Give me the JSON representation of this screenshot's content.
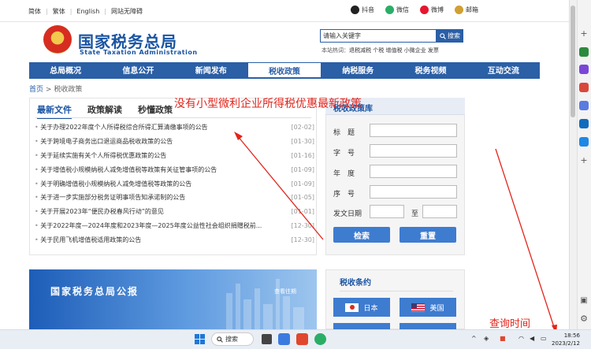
{
  "top_links": [
    "简体",
    "繁体",
    "English",
    "网站无障碍"
  ],
  "social": [
    {
      "label": "抖音",
      "color": "#222222"
    },
    {
      "label": "微信",
      "color": "#2aae67"
    },
    {
      "label": "微博",
      "color": "#e6162d"
    },
    {
      "label": "邮箱",
      "color": "#d0a030"
    }
  ],
  "header": {
    "logo_cn": "国家税务总局",
    "logo_en": "State Taxation Administration"
  },
  "search": {
    "value": "请输入关键字",
    "button": "搜索",
    "hot_label": "本站热词：",
    "hot_terms": "退税减税 个税 增值税 小微企业 发票"
  },
  "nav": [
    {
      "label": "总局概况",
      "active": false
    },
    {
      "label": "信息公开",
      "active": false
    },
    {
      "label": "新闻发布",
      "active": false
    },
    {
      "label": "税收政策",
      "active": true
    },
    {
      "label": "纳税服务",
      "active": false
    },
    {
      "label": "税务视频",
      "active": false
    },
    {
      "label": "互动交流",
      "active": false
    }
  ],
  "breadcrumb": {
    "home": "首页",
    "sep": ">",
    "current": "税收政策"
  },
  "tabs": [
    {
      "label": "最新文件",
      "active": true
    },
    {
      "label": "政策解读",
      "active": false
    },
    {
      "label": "秒懂政策",
      "active": false
    }
  ],
  "news": [
    {
      "title": "关于办理2022年度个人所得税综合所得汇算清缴事项的公告",
      "date": "[02-02]"
    },
    {
      "title": "关于跨境电子商务出口退运商品税收政策的公告",
      "date": "[01-30]"
    },
    {
      "title": "关于延续实施有关个人所得税优惠政策的公告",
      "date": "[01-16]"
    },
    {
      "title": "关于增值税小规模纳税人减免增值税等政策有关征管事项的公告",
      "date": "[01-09]"
    },
    {
      "title": "关于明确增值税小规模纳税人减免增值税等政策的公告",
      "date": "[01-09]"
    },
    {
      "title": "关于进一步实施部分税务证明事项告知承诺制的公告",
      "date": "[01-05]"
    },
    {
      "title": "关于开展2023年“便民办税春风行动”的意见",
      "date": "[01-01]"
    },
    {
      "title": "关于2022年度—2024年度和2023年度—2025年度公益性社会组织捐赠税前...",
      "date": "[12-30]"
    },
    {
      "title": "关于民用飞机增值税适用政策的公告",
      "date": "[12-30]"
    }
  ],
  "annotation_top": "没有小型微利企业所得税优惠最新政策",
  "annotation_bottom": "查询时间",
  "database": {
    "title": "税收政策库",
    "fields": [
      "标　题",
      "字　号",
      "年　度",
      "序　号"
    ],
    "date_label": "发文日期",
    "date_to": "至",
    "query_button": "检索",
    "reset_button": "重置"
  },
  "bulletin": {
    "title": "国家税务总局公报",
    "more": "查看往期"
  },
  "treaty": {
    "title": "税收条约",
    "countries": [
      "日本",
      "美国"
    ]
  },
  "taskbar": {
    "search": "搜索",
    "time": "18:56",
    "date": "2023/2/12"
  }
}
